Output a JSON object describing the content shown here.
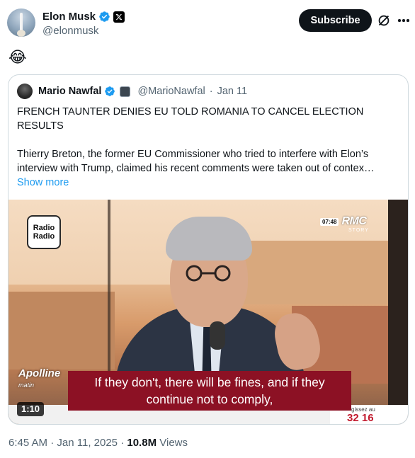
{
  "author": {
    "name": "Elon Musk",
    "handle": "@elonmusk",
    "verified_icon": "verified-badge-icon",
    "affiliate_icon": "x-logo-icon"
  },
  "actions": {
    "subscribe_label": "Subscribe",
    "grok_icon": "grok-icon",
    "more_icon": "more-options-icon"
  },
  "tweet": {
    "text": "😂"
  },
  "quote": {
    "author_name": "Mario Nawfal",
    "author_handle": "@MarioNawfal",
    "separator": "·",
    "date": "Jan 11",
    "headline": "FRENCH TAUNTER DENIES EU TOLD ROMANIA TO CANCEL ELECTION RESULTS",
    "body_line1": "Thierry Breton, the former EU Commissioner who tried to interfere with Elon’s",
    "body_line2": "interview with Trump, claimed his recent comments were taken out of contex…",
    "show_more": "Show more"
  },
  "video": {
    "duration": "1:10",
    "channel_logo": "Radio\nRadio",
    "channel_logo_line1": "Radio",
    "channel_logo_line2": "Radio",
    "broadcaster_time": "07:48",
    "broadcaster_name": "RMC",
    "broadcaster_sub": "STORY",
    "show_name": "Apolline",
    "show_name_sub": "matin",
    "subtitle_line1": "If they don't, there will be fines, and if they",
    "subtitle_line2": "continue not to comply,",
    "ticker_right_line1": "gissez au",
    "ticker_right_line2": "32 16"
  },
  "meta": {
    "time": "6:45 AM",
    "date": "Jan 11, 2025",
    "views_count": "10.8M",
    "views_label": "Views",
    "separator": "·"
  },
  "colors": {
    "accent": "#1d9bf0",
    "subtitle_bg": "#8c1124",
    "button_bg": "#0f1419"
  }
}
